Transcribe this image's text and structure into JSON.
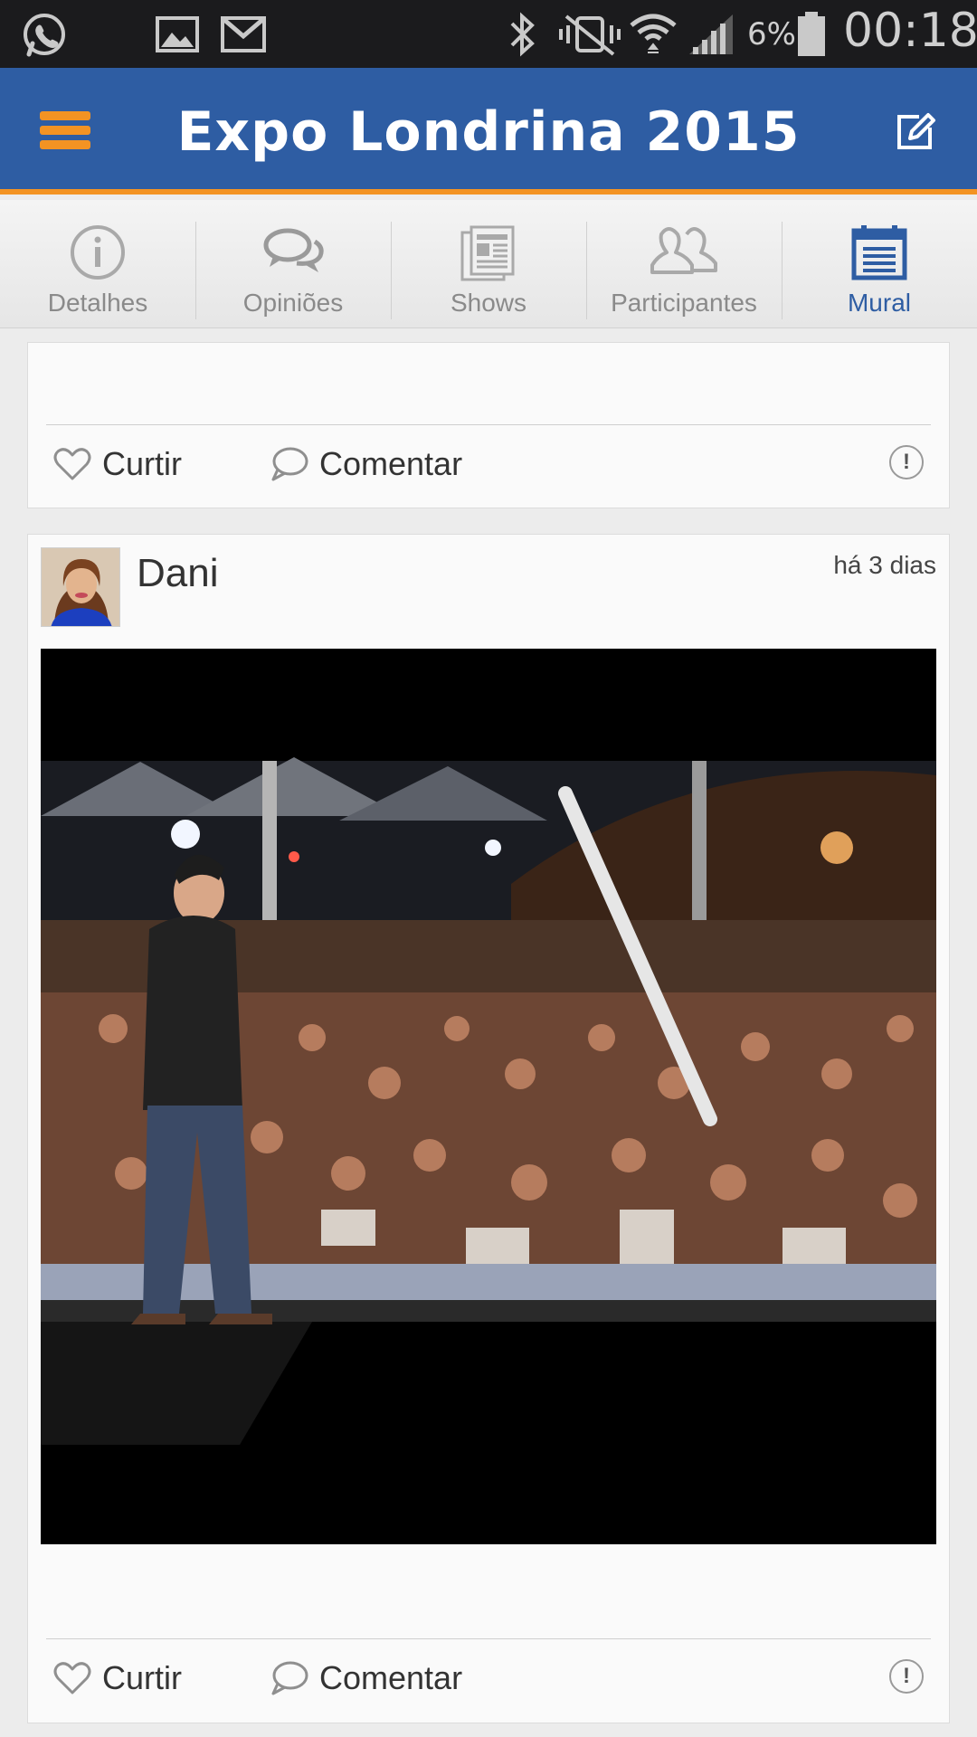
{
  "status_bar": {
    "battery": "6%",
    "time": "00:18"
  },
  "app_bar": {
    "title": "Expo Londrina 2015"
  },
  "tabs": [
    {
      "label": "Detalhes",
      "icon": "info-icon",
      "active": false
    },
    {
      "label": "Opiniões",
      "icon": "chat-bubbles-icon",
      "active": false
    },
    {
      "label": "Shows",
      "icon": "newspaper-icon",
      "active": false
    },
    {
      "label": "Participantes",
      "icon": "people-icon",
      "active": false
    },
    {
      "label": "Mural",
      "icon": "calendar-board-icon",
      "active": true
    }
  ],
  "posts": [
    {
      "like_label": "Curtir",
      "comment_label": "Comentar",
      "report_label": "!"
    },
    {
      "author": "Dani",
      "time": "há 3 dias",
      "like_label": "Curtir",
      "comment_label": "Comentar",
      "report_label": "!"
    }
  ],
  "colors": {
    "app_bar": "#2e5da3",
    "accent": "#f39323",
    "active_tab": "#2e5da3",
    "inactive_tab": "#8a8a8a"
  }
}
